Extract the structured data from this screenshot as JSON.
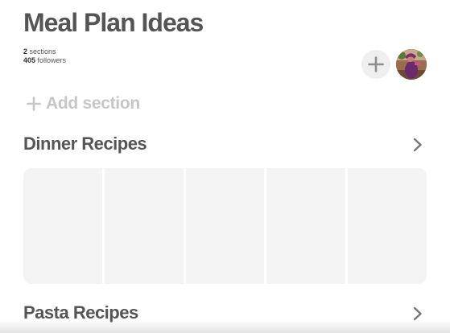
{
  "board": {
    "title": "Meal Plan Ideas",
    "sections_count": "2",
    "sections_label": "sections",
    "followers_count": "405",
    "followers_label": "followers"
  },
  "actions": {
    "add_icon": "plus-icon",
    "avatar": "user-avatar"
  },
  "add_section": {
    "icon": "plus-icon",
    "label": "Add section"
  },
  "sections": [
    {
      "title": "Dinner Recipes",
      "icon": "chevron-right-icon",
      "tile_count": 5
    },
    {
      "title": "Pasta Recipes",
      "icon": "chevron-right-icon"
    }
  ],
  "colors": {
    "title_text": "#555555",
    "muted_text": "#c6c6c6",
    "tile_placeholder": "#f4f4f4",
    "add_button_bg": "#efefef"
  }
}
